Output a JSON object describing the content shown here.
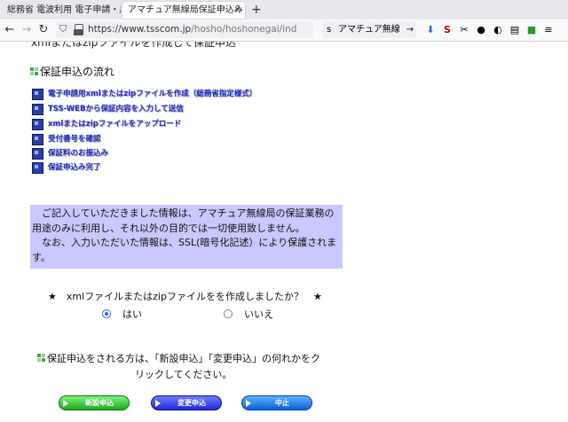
{
  "tabs": [
    {
      "title": "総務省 電波利用 電子申請・届",
      "active": false
    },
    {
      "title": "アマチュア無線局保証申込み",
      "active": true
    }
  ],
  "toolbar": {
    "url_main": "https://www.tsscom.jp",
    "url_rest": "/hosho/hoshonegai/ind",
    "search_text": "アマチュア無線",
    "search_prefix": "s"
  },
  "page": {
    "clipped_text": "xmlまたはzipファイルを作成して保証申込",
    "flow_heading": "保証申込の流れ",
    "flow_steps": [
      "電子申請用xmlまたはzipファイルを作成（総務省指定様式）",
      "TSS-WEBから保証内容を入力して送信",
      "xmlまたはzipファイルをアップロード",
      "受付番号を確認",
      "保証料のお振込み",
      "保証申込み完了"
    ],
    "notice_lines": [
      "　ご記入していただきました情報は、アマチュア無線局の保証業務の",
      "用途のみに利用し、それ以外の目的では一切使用致しません。",
      "　なお、入力いただいた情報は、SSL(暗号化記述）により保護されま",
      "す。"
    ],
    "question": "★　xmlファイルまたはzipファイルをを作成しましたか？　★",
    "radio_yes": "はい",
    "radio_no": "いいえ",
    "instruction_line1": "保証申込をされる方は、「新設申込」「変更申込」の何れかをク",
    "instruction_line2": "リックしてください。",
    "buttons": {
      "new": "新設申込",
      "change": "変更申込",
      "cancel": "中止"
    }
  },
  "colors": {
    "notice_bg": "#c8c8ff",
    "step_text": "#1d2ab8",
    "step_icon": "#2a3fa6"
  }
}
